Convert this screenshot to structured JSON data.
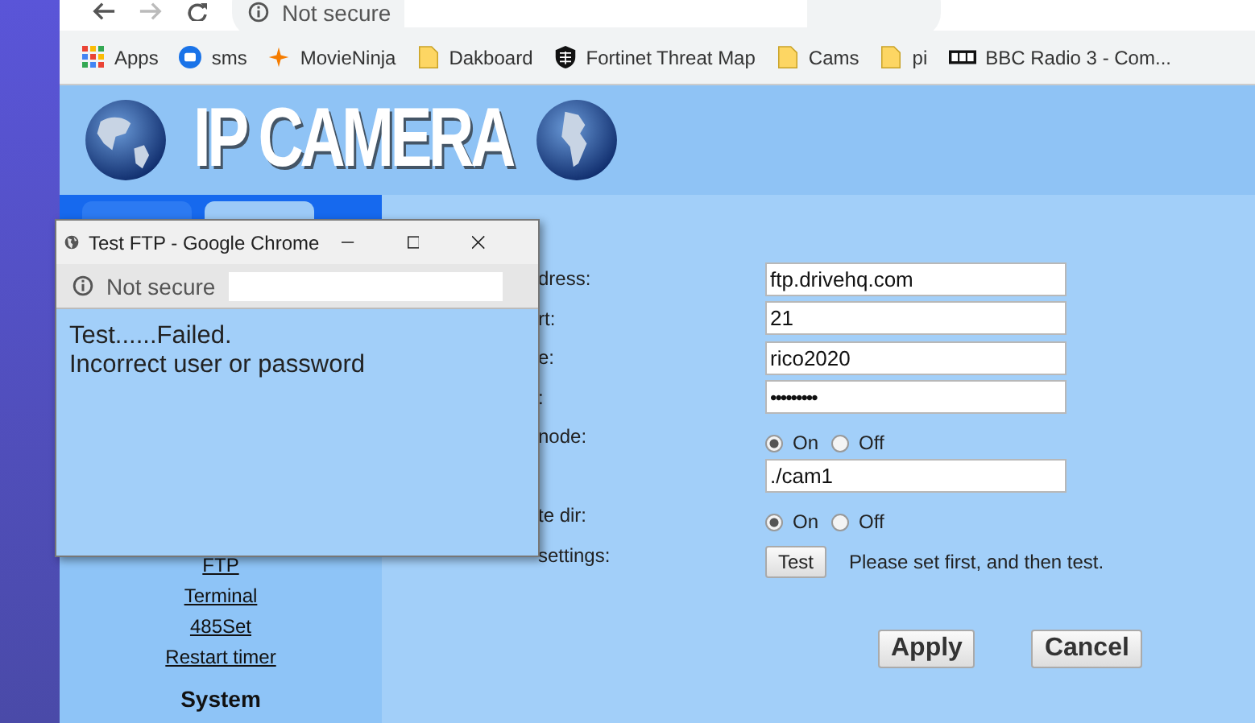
{
  "browser": {
    "security": "Not secure",
    "bookmarks": [
      {
        "label": "Apps",
        "kind": "apps"
      },
      {
        "label": "sms",
        "kind": "chat"
      },
      {
        "label": "MovieNinja",
        "kind": "star"
      },
      {
        "label": "Dakboard",
        "kind": "folder"
      },
      {
        "label": "Fortinet Threat Map",
        "kind": "shield"
      },
      {
        "label": "Cams",
        "kind": "folder"
      },
      {
        "label": "pi",
        "kind": "folder"
      },
      {
        "label": "BBC Radio 3 - Com...",
        "kind": "radio"
      }
    ]
  },
  "header": {
    "title": "IP CAMERA"
  },
  "sidebar": {
    "tabs": [
      {
        "selected": false
      },
      {
        "selected": true
      }
    ],
    "links": [
      "FTP",
      "Terminal",
      "485Set",
      "Restart timer"
    ],
    "section": "System"
  },
  "form": {
    "rows": [
      {
        "kind": "text",
        "label": "dress:",
        "value": "ftp.drivehq.com"
      },
      {
        "kind": "text",
        "label": "rt:",
        "value": "21"
      },
      {
        "kind": "text",
        "label": "e:",
        "value": "rico2020"
      },
      {
        "kind": "password",
        "label": ":",
        "value": "•••••••••"
      },
      {
        "kind": "radio",
        "label": "node:",
        "options": [
          {
            "label": "On",
            "selected": true
          },
          {
            "label": "Off",
            "selected": false
          }
        ]
      },
      {
        "kind": "text",
        "value": "./cam1"
      },
      {
        "kind": "radio",
        "label": "te dir:",
        "options": [
          {
            "label": "On",
            "selected": true
          },
          {
            "label": "Off",
            "selected": false
          }
        ]
      },
      {
        "kind": "test",
        "label": "settings:",
        "button": "Test",
        "note": "Please set first, and then test."
      }
    ],
    "buttons": [
      "Apply",
      "Cancel"
    ]
  },
  "popup": {
    "title": "Test FTP - Google Chrome",
    "security": "Not secure",
    "lines": [
      "Test......Failed.",
      "Incorrect user or password"
    ]
  }
}
